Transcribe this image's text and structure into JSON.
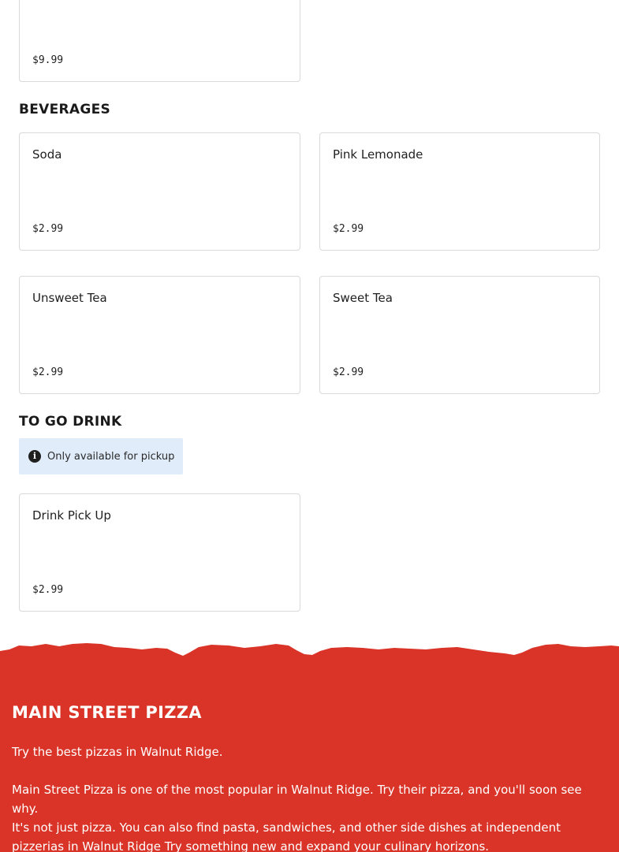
{
  "top_card": {
    "price": "$9.99"
  },
  "sections": {
    "beverages": {
      "title": "BEVERAGES",
      "items": [
        {
          "name": "Soda",
          "price": "$2.99"
        },
        {
          "name": "Pink Lemonade",
          "price": "$2.99"
        },
        {
          "name": "Unsweet Tea",
          "price": "$2.99"
        },
        {
          "name": "Sweet Tea",
          "price": "$2.99"
        }
      ]
    },
    "to_go_drink": {
      "title": "TO GO DRINK",
      "notice": "Only available for pickup",
      "notice_icon": "info-icon",
      "items": [
        {
          "name": "Drink Pick Up",
          "price": "$2.99"
        }
      ]
    }
  },
  "footer": {
    "background_color": "#d93427",
    "title": "MAIN STREET PIZZA",
    "paragraphs": [
      "Try the best pizzas in Walnut Ridge.",
      "Main Street Pizza is one of the most popular in Walnut Ridge. Try their pizza, and you'll soon see why.",
      "It's not just pizza. You can also find pasta, sandwiches, and other side dishes at independent pizzerias in Walnut Ridge Try something new and expand your culinary horizons."
    ]
  }
}
